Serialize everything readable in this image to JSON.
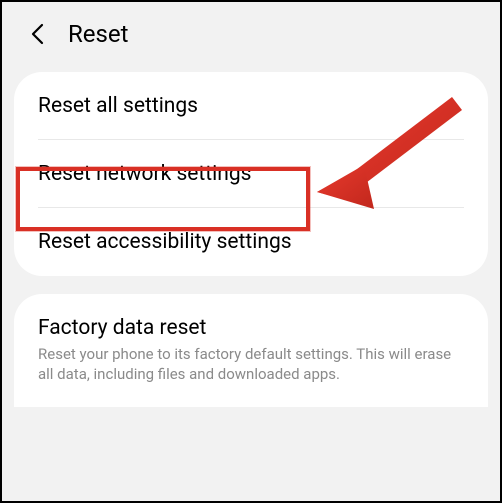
{
  "header": {
    "title": "Reset"
  },
  "card1": {
    "items": [
      {
        "title": "Reset all settings"
      },
      {
        "title": "Reset network settings"
      },
      {
        "title": "Reset accessibility settings"
      }
    ]
  },
  "card2": {
    "title": "Factory data reset",
    "subtitle": "Reset your phone to its factory default settings. This will erase all data, including files and downloaded apps."
  },
  "annotation": {
    "highlight_color": "#d93025",
    "arrow_color": "#d93025"
  }
}
